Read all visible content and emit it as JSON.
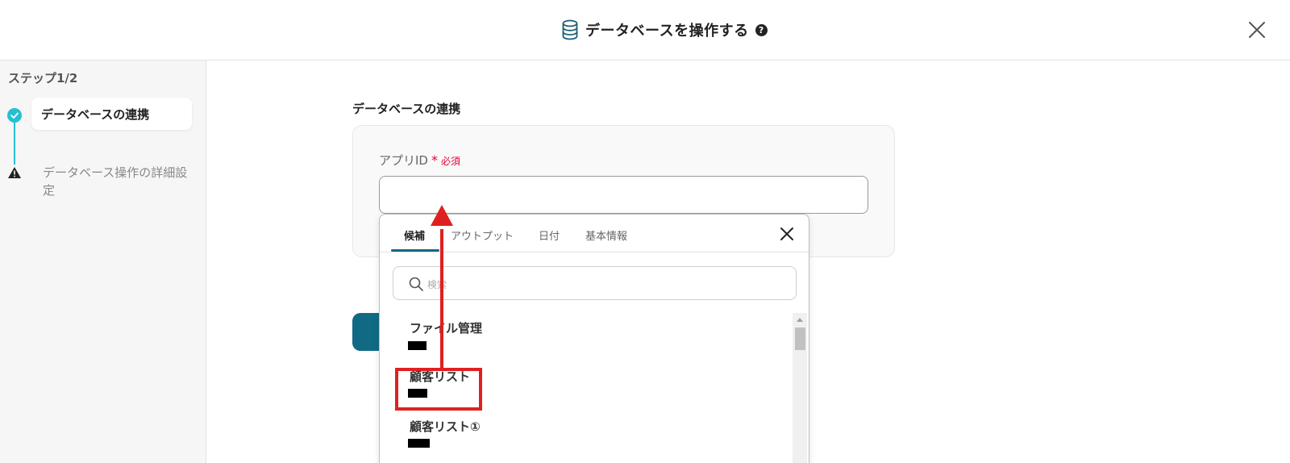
{
  "header": {
    "title": "データベースを操作する",
    "help_glyph": "?",
    "icons": {
      "database": "database-icon",
      "help": "help-icon",
      "close": "close-icon"
    }
  },
  "sidebar": {
    "step_count": "ステップ1/2",
    "steps": [
      {
        "label": "データベースの連携",
        "status": "done",
        "icon": "check-icon"
      },
      {
        "label": "データベース操作の詳細設定",
        "status": "warning",
        "icon": "warning-icon"
      }
    ]
  },
  "main": {
    "section_title": "データベースの連携",
    "field": {
      "label": "アプリID",
      "asterisk": "*",
      "required": "必須",
      "value": ""
    }
  },
  "popup": {
    "tabs": [
      {
        "label": "候補",
        "active": true
      },
      {
        "label": "アウトプット",
        "active": false
      },
      {
        "label": "日付",
        "active": false
      },
      {
        "label": "基本情報",
        "active": false
      }
    ],
    "search_placeholder": "検索",
    "items": [
      {
        "title": "ファイル管理"
      },
      {
        "title": "顧客リスト",
        "highlighted": true
      },
      {
        "title": "顧客リスト①"
      }
    ]
  },
  "colors": {
    "accent": "#116a83",
    "step_done": "#26bfd2",
    "required": "#e4003a",
    "annotation": "#e02020"
  }
}
